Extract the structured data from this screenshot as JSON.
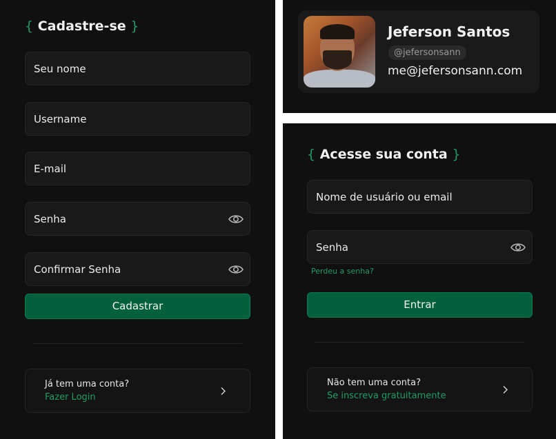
{
  "signup": {
    "title": "Cadastre-se",
    "brace_open": "{",
    "brace_close": "}",
    "fields": {
      "name_placeholder": "Seu nome",
      "username_placeholder": "Username",
      "email_placeholder": "E-mail",
      "password_placeholder": "Senha",
      "confirm_placeholder": "Confirmar Senha"
    },
    "submit_label": "Cadastrar",
    "login_card": {
      "question": "Já tem uma conta?",
      "action": "Fazer Login"
    }
  },
  "profile": {
    "name": "Jeferson Santos",
    "handle": "@jefersonsann",
    "email": "me@jefersonsann.com"
  },
  "login": {
    "title": "Acesse sua conta",
    "brace_open": "{",
    "brace_close": "}",
    "fields": {
      "user_placeholder": "Nome de usuário ou email",
      "password_placeholder": "Senha"
    },
    "forgot_label": "Perdeu a senha?",
    "submit_label": "Entrar",
    "signup_card": {
      "question": "Não tem uma conta?",
      "action": "Se inscreva gratuitamente"
    }
  },
  "colors": {
    "accent": "#1f9d63",
    "button": "#03603d",
    "background": "#101010",
    "field": "#191919"
  },
  "icons": {
    "eye": "eye-icon",
    "chevron": "chevron-right-icon"
  }
}
